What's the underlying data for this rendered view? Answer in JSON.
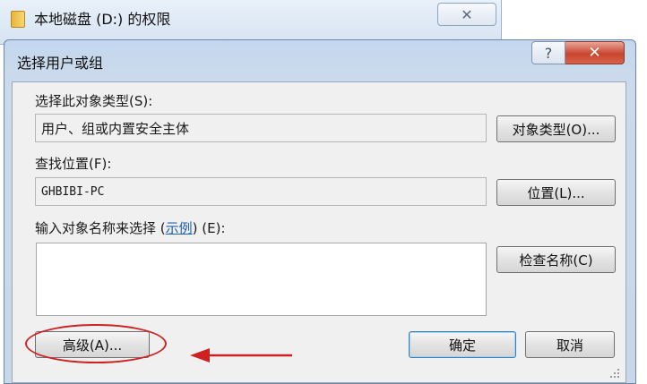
{
  "background_window": {
    "title": "本地磁盘 (D:) 的权限",
    "close_glyph": "✕"
  },
  "dialog": {
    "title": "选择用户或组",
    "help_glyph": "?",
    "close_glyph": "✕"
  },
  "object_type": {
    "label": "选择此对象类型(S):",
    "value": "用户、组或内置安全主体",
    "button_label": "对象类型(O)..."
  },
  "location": {
    "label": "查找位置(F):",
    "value": "GHBIBI-PC",
    "button_label": "位置(L)..."
  },
  "names": {
    "label_prefix": "输入对象名称来选择 (",
    "label_link": "示例",
    "label_suffix": ") (E):",
    "value": "",
    "check_button_label": "检查名称(C)"
  },
  "footer": {
    "advanced_label": "高级(A)...",
    "ok_label": "确定",
    "cancel_label": "取消"
  },
  "annotations": {
    "highlight_color": "#cc2222"
  }
}
